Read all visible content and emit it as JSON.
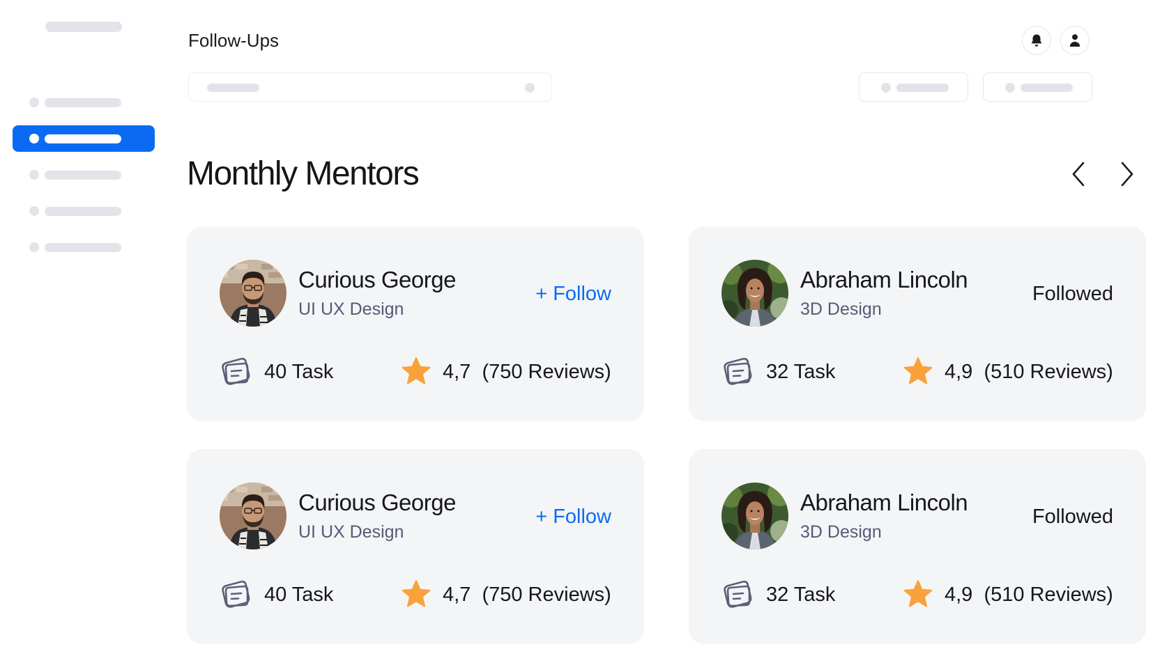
{
  "header": {
    "title": "Follow-Ups"
  },
  "section": {
    "title": "Monthly Mentors"
  },
  "mentors": [
    {
      "name": "Curious George",
      "role": "UI UX Design",
      "action": "+ Follow",
      "tasks": "40 Task",
      "rating": "4,7",
      "reviews": "(750 Reviews)",
      "followed": false
    },
    {
      "name": "Abraham Lincoln",
      "role": "3D Design",
      "action": "Followed",
      "tasks": "32 Task",
      "rating": "4,9",
      "reviews": "(510 Reviews)",
      "followed": true
    },
    {
      "name": "Curious George",
      "role": "UI UX Design",
      "action": "+ Follow",
      "tasks": "40 Task",
      "rating": "4,7",
      "reviews": "(750 Reviews)",
      "followed": false
    },
    {
      "name": "Abraham Lincoln",
      "role": "3D Design",
      "action": "Followed",
      "tasks": "32 Task",
      "rating": "4,9",
      "reviews": "(510 Reviews)",
      "followed": true
    }
  ],
  "icons": {
    "notification": "bell-icon",
    "profile": "user-icon",
    "previous": "chevron-left-icon",
    "next": "chevron-right-icon",
    "task": "task-icon",
    "rating": "star-icon"
  },
  "colors": {
    "accent": "#0a6bf2",
    "star": "#f9a23b",
    "card_bg": "#f4f5f7"
  }
}
